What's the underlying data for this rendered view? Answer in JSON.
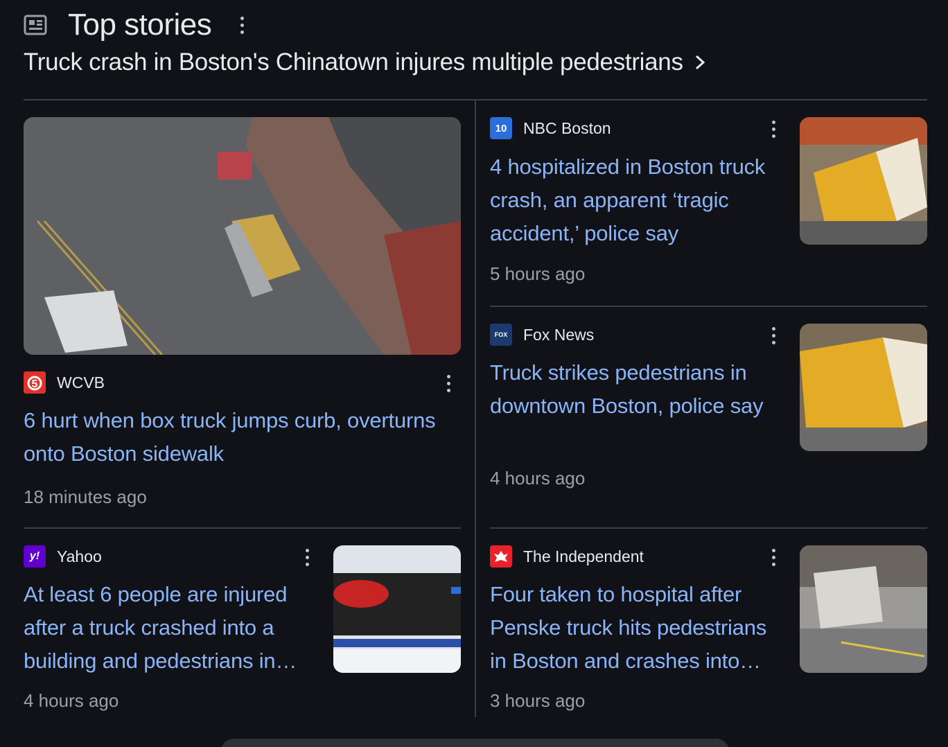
{
  "header": {
    "title": "Top stories",
    "icon": "newspaper-icon"
  },
  "story": {
    "title": "Truck crash in Boston's Chinatown injures multiple pedestrians"
  },
  "articles": [
    {
      "source": "WCVB",
      "headline": "6 hurt when box truck jumps curb, overturns onto Boston sidewalk",
      "time": "18 minutes ago",
      "favicon_color": "#e0312b"
    },
    {
      "source": "NBC Boston",
      "headline": "4 hospitalized in Boston truck crash, an apparent ‘tragic accident,’ police say",
      "time": "5 hours ago",
      "favicon_color": "#2b6ed9",
      "favicon_text": "10"
    },
    {
      "source": "Fox News",
      "headline": "Truck strikes pedestrians in downtown Boston, police say",
      "time": "4 hours ago",
      "favicon_color": "#1c3a6e"
    },
    {
      "source": "Yahoo",
      "headline": "At least 6 people are injured after a truck crashed into a building and pedestrians in…",
      "time": "4 hours ago",
      "favicon_color": "#6001d2",
      "favicon_text": "y!"
    },
    {
      "source": "The Independent",
      "headline": "Four taken to hospital after Penske truck hits pedestrians in Boston and crashes into…",
      "time": "3 hours ago",
      "favicon_color": "#e8212a"
    }
  ],
  "colors": {
    "background": "#111217",
    "link": "#8ab4f8",
    "text": "#e8eaed",
    "muted": "#9aa0a6",
    "divider": "#3c4043"
  }
}
